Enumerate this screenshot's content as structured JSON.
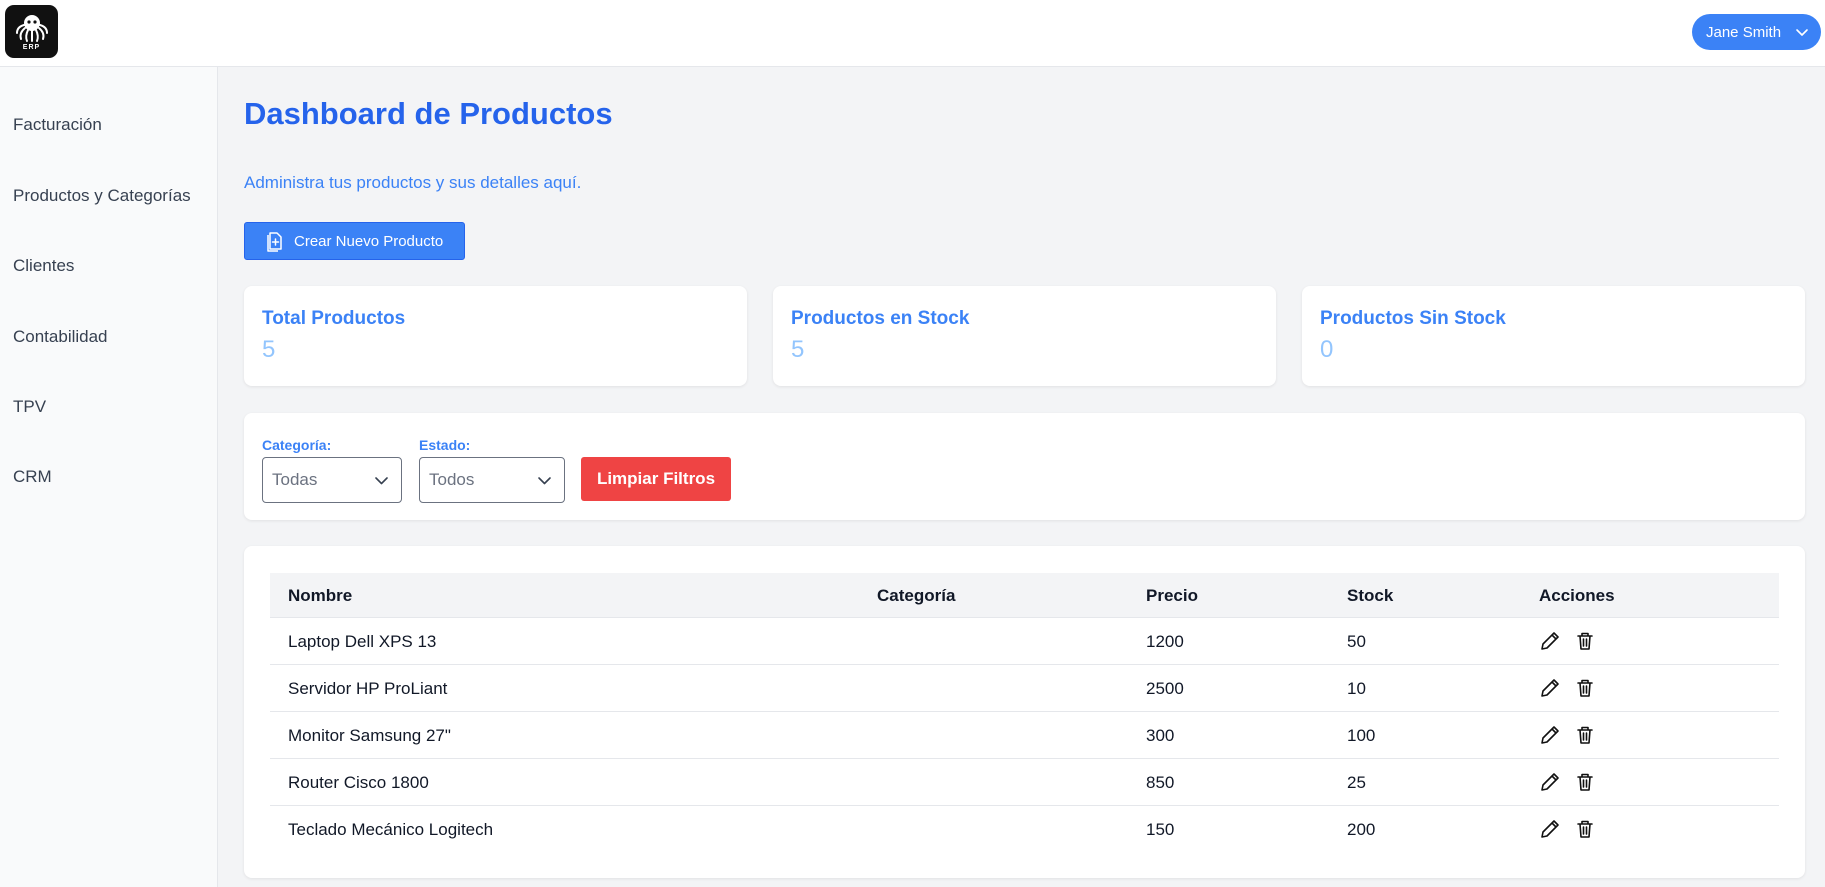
{
  "header": {
    "logo_text": "ERP",
    "user_name": "Jane Smith"
  },
  "sidebar": {
    "items": [
      {
        "label": "Facturación"
      },
      {
        "label": "Productos y Categorías"
      },
      {
        "label": "Clientes"
      },
      {
        "label": "Contabilidad"
      },
      {
        "label": "TPV"
      },
      {
        "label": "CRM"
      }
    ]
  },
  "main": {
    "title": "Dashboard de Productos",
    "subtitle": "Administra tus productos y sus detalles aquí.",
    "create_button": "Crear Nuevo Producto"
  },
  "stats": [
    {
      "label": "Total Productos",
      "value": "5"
    },
    {
      "label": "Productos en Stock",
      "value": "5"
    },
    {
      "label": "Productos Sin Stock",
      "value": "0"
    }
  ],
  "filters": {
    "category_label": "Categoría:",
    "category_value": "Todas",
    "state_label": "Estado:",
    "state_value": "Todos",
    "clear_button": "Limpiar Filtros"
  },
  "table": {
    "headers": [
      "Nombre",
      "Categoría",
      "Precio",
      "Stock",
      "Acciones"
    ],
    "rows": [
      {
        "name": "Laptop Dell XPS 13",
        "category": "",
        "price": "1200",
        "stock": "50"
      },
      {
        "name": "Servidor HP ProLiant",
        "category": "",
        "price": "2500",
        "stock": "10"
      },
      {
        "name": "Monitor Samsung 27\"",
        "category": "",
        "price": "300",
        "stock": "100"
      },
      {
        "name": "Router Cisco 1800",
        "category": "",
        "price": "850",
        "stock": "25"
      },
      {
        "name": "Teclado Mecánico Logitech",
        "category": "",
        "price": "150",
        "stock": "200"
      }
    ]
  },
  "icons": {
    "logo": "octopus-icon",
    "user_dropdown": "chevron-down-icon",
    "create": "file-plus-icon",
    "select": "chevron-down-icon",
    "edit": "pencil-icon",
    "delete": "trash-icon"
  },
  "colors": {
    "accent": "#3b82f6",
    "title": "#2563eb",
    "danger": "#ef4444",
    "stat_value": "#93c5fd"
  }
}
